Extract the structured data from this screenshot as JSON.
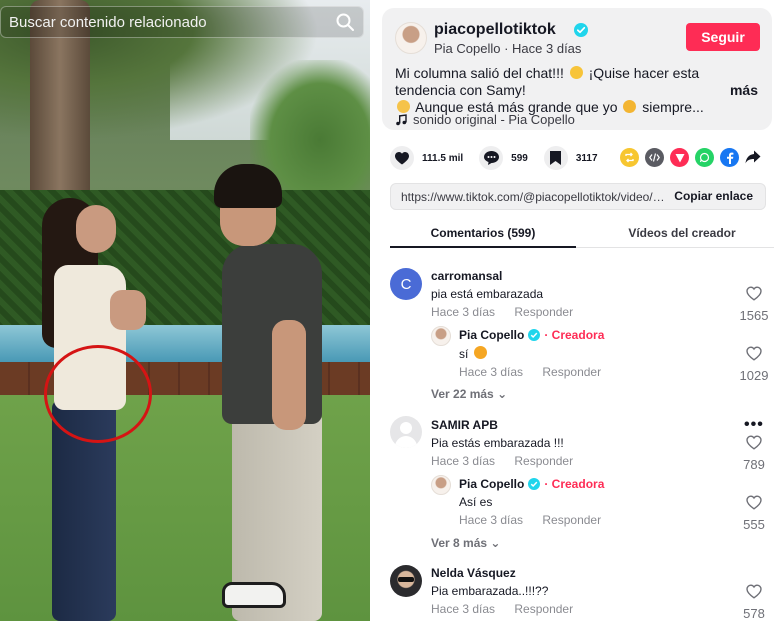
{
  "search": {
    "placeholder": "Buscar contenido relacionado"
  },
  "post": {
    "username": "piacopellotiktok",
    "subline": "Pia Copello · Hace 3 días",
    "follow_label": "Seguir",
    "desc_1": "Mi columna salió del chat!!!",
    "desc_2": "¡Quise hacer esta tendencia con Samy!",
    "desc_3": "Aunque está más grande que yo",
    "desc_4": "siempre...",
    "more_label": "más",
    "sound": "sonido original - Pia Copello"
  },
  "actions": {
    "likes": "111.5 mil",
    "comments": "599",
    "saves": "3117"
  },
  "share_icons": [
    "repost-icon",
    "embed-icon",
    "send-icon",
    "whatsapp-icon",
    "facebook-icon",
    "share-arrow-icon"
  ],
  "link": {
    "url": "https://www.tiktok.com/@piacopellotiktok/video/7...",
    "copy_label": "Copiar enlace"
  },
  "tabs": {
    "comments": "Comentarios (599)",
    "creator_videos": "Vídeos del creador"
  },
  "comments": [
    {
      "name": "carromansal",
      "avatar_letter": "C",
      "text": "pia está embarazada",
      "time": "Hace 3 días",
      "reply": "Responder",
      "likes": "1565",
      "creator_reply": {
        "name": "Pia Copello",
        "badge": "· Creadora",
        "text": "sí",
        "time": "Hace 3 días",
        "reply": "Responder",
        "likes": "1029"
      },
      "view_more": "Ver 22 más"
    },
    {
      "name": "SAMIR APB",
      "text": "Pia estás embarazada !!!",
      "time": "Hace 3 días",
      "reply": "Responder",
      "likes": "789",
      "creator_reply": {
        "name": "Pia Copello",
        "badge": "· Creadora",
        "text": "Así es",
        "time": "Hace 3 días",
        "reply": "Responder",
        "likes": "555"
      },
      "view_more": "Ver 8 más"
    },
    {
      "name": "Nelda Vásquez",
      "text": "Pia embarazada..!!!??",
      "time": "Hace 3 días",
      "reply": "Responder",
      "likes": "578"
    }
  ],
  "colors": {
    "accent": "#fe2c55",
    "verified": "#20d5ec",
    "avatar_c": "#4a6bd6"
  }
}
